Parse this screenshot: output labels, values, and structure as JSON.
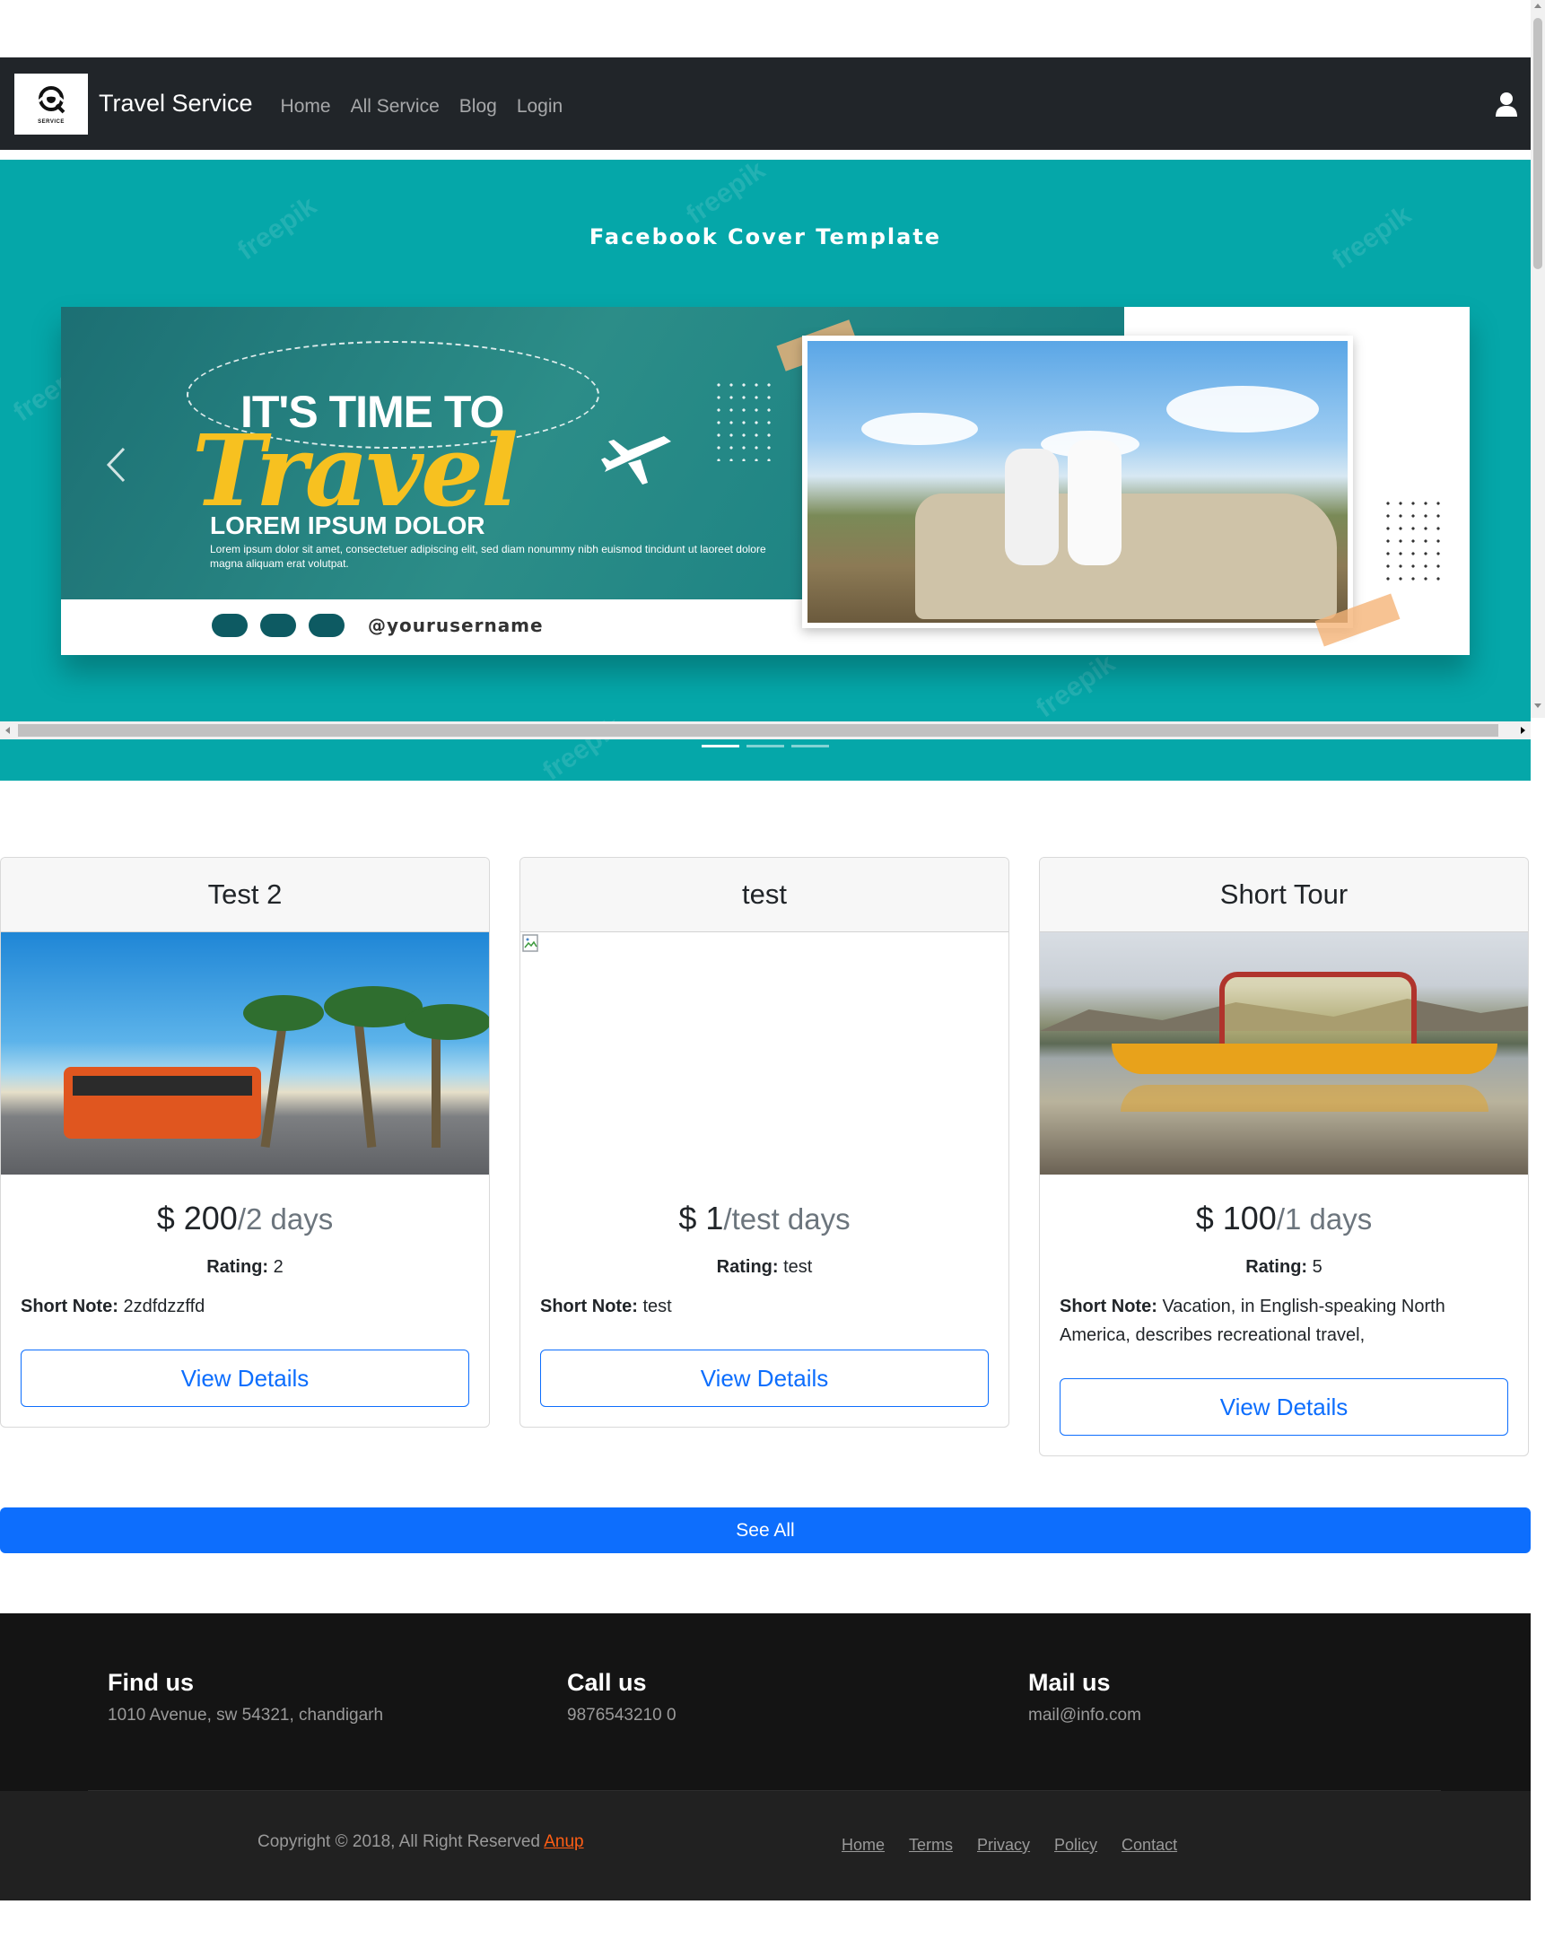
{
  "navbar": {
    "brand_name": "Travel Service",
    "logo_caption": "SERVICE",
    "links": [
      "Home",
      "All Service",
      "Blog",
      "Login"
    ]
  },
  "carousel": {
    "title": "Facebook Cover Template",
    "headline_top": "IT'S TIME TO",
    "headline_script": "Travel",
    "subheading": "LOREM IPSUM DOLOR",
    "body": "Lorem ipsum dolor sit amet, consectetuer adipiscing elit, sed diam nonummy nibh euismod tincidunt ut laoreet dolore magna aliquam erat volutpat.",
    "handle": "@yourusername",
    "watermark": "freepik",
    "slide_count": 3,
    "active_slide": 1
  },
  "services": [
    {
      "title": "Test 2",
      "currency": "$ ",
      "price": "200",
      "duration": "/2 days",
      "rating_label": "Rating:",
      "rating": " 2",
      "note_label": "Short Note:",
      "note": " 2zdfdzzffd",
      "button": "View Details",
      "image": "bus-beach"
    },
    {
      "title": "test",
      "currency": "$ ",
      "price": "1",
      "duration": "/test days",
      "rating_label": "Rating:",
      "rating": " test",
      "note_label": "Short Note:",
      "note": " test",
      "button": "View Details",
      "image": "broken-image"
    },
    {
      "title": "Short Tour",
      "currency": "$ ",
      "price": "100",
      "duration": "/1 days",
      "rating_label": "Rating:",
      "rating": " 5",
      "note_label": "Short Note:",
      "note": " Vacation, in English-speaking North America, describes recreational travel,",
      "button": "View Details",
      "image": "boat-lake"
    }
  ],
  "see_all": "See All",
  "footer": {
    "find_us": {
      "title": "Find us",
      "text": "1010 Avenue, sw 54321, chandigarh"
    },
    "call_us": {
      "title": "Call us",
      "text": "9876543210 0"
    },
    "mail_us": {
      "title": "Mail us",
      "text": "mail@info.com"
    },
    "copyright": "Copyright © 2018, All Right Reserved ",
    "copyright_link": "Anup",
    "links": [
      "Home",
      "Terms",
      "Privacy",
      "Policy",
      "Contact"
    ]
  },
  "colors": {
    "navbar_bg": "#212529",
    "carousel_bg": "#05a7a9",
    "primary": "#0d6efd",
    "footer_bg": "#141414",
    "accent_link": "#ff5e14"
  }
}
